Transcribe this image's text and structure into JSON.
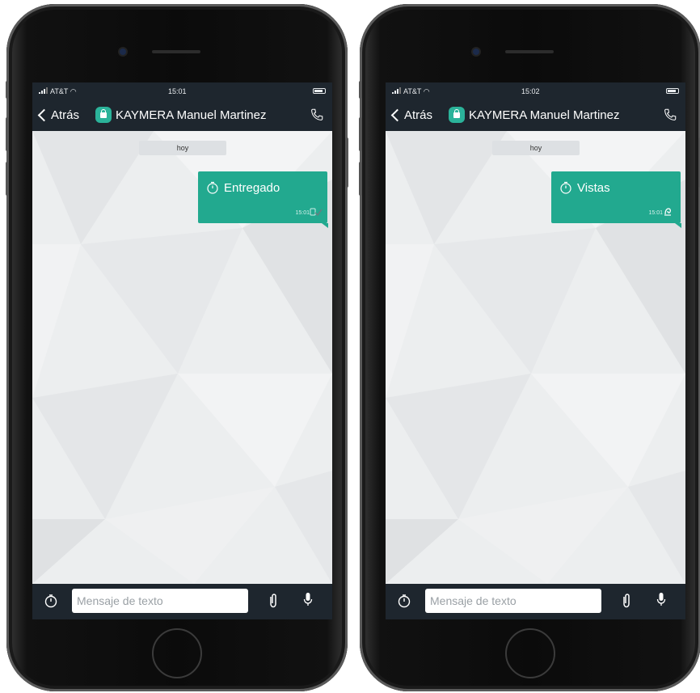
{
  "phones": [
    {
      "status": {
        "carrier": "AT&T",
        "time": "15:01"
      },
      "nav": {
        "back_label": "Atrás",
        "contact_name": "KAYMERA Manuel  Martinez"
      },
      "day_label": "hoy",
      "message": {
        "text": "Entregado",
        "time": "15:01",
        "status_icon": "delivered-check-icon"
      },
      "input": {
        "placeholder": "Mensaje de texto"
      }
    },
    {
      "status": {
        "carrier": "AT&T",
        "time": "15:02"
      },
      "nav": {
        "back_label": "Atrás",
        "contact_name": "KAYMERA Manuel  Martinez"
      },
      "day_label": "hoy",
      "message": {
        "text": "Vistas",
        "time": "15:01",
        "status_icon": "seen-eye-icon"
      },
      "input": {
        "placeholder": "Mensaje de texto"
      }
    }
  ],
  "colors": {
    "bar": "#1e262e",
    "accent": "#22a98f",
    "chat_bg": "#eceeef"
  }
}
